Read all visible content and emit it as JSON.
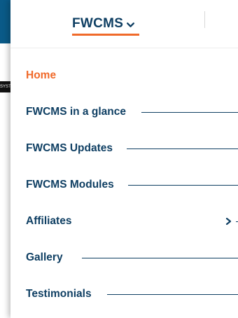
{
  "header": {
    "brand": "FWCMS",
    "brand_icon": "chevron-down-icon"
  },
  "background": {
    "clipped_label": "SYSTEM"
  },
  "menu": {
    "items": [
      {
        "label": "Home",
        "active": true
      },
      {
        "label": "FWCMS in a glance"
      },
      {
        "label": "FWCMS Updates"
      },
      {
        "label": "FWCMS Modules"
      },
      {
        "label": "Affiliates",
        "icon": "chevron-right-icon"
      },
      {
        "label": "Gallery"
      },
      {
        "label": "Testimonials"
      }
    ]
  },
  "colors": {
    "primary": "#0f3f63",
    "accent": "#f06a2a",
    "background_blue": "#0a5a88"
  }
}
